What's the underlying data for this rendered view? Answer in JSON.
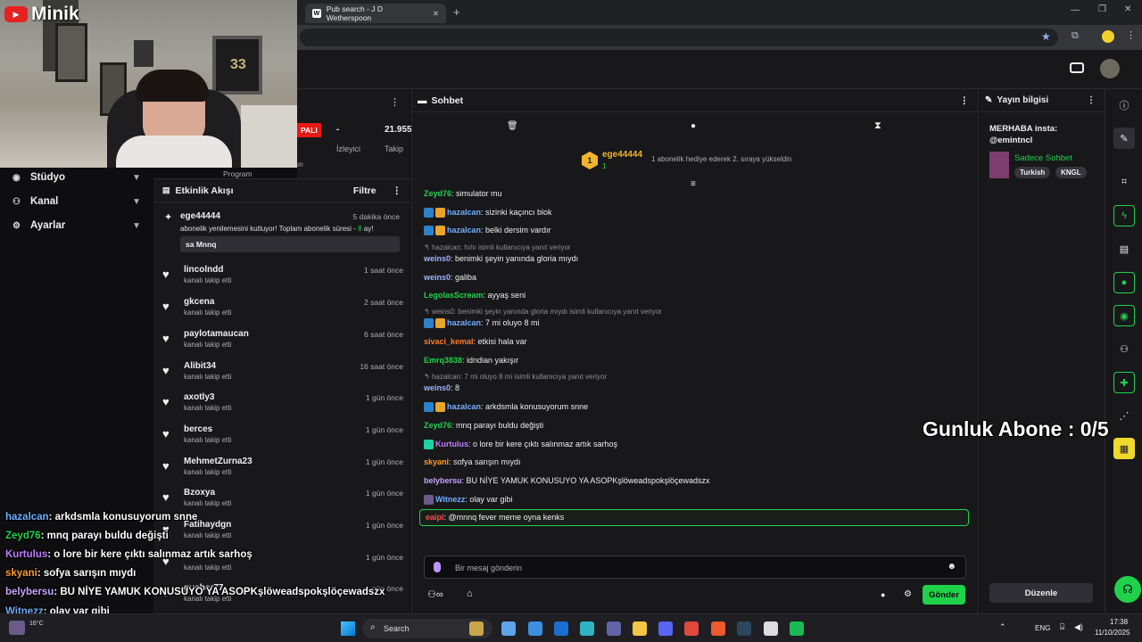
{
  "browser": {
    "tab_title": "Pub search - J D Wetherspoon",
    "tab_favicon": "W"
  },
  "webcam": {
    "logo_text": "Minik",
    "frame_text": "33"
  },
  "left_nav": {
    "items": [
      {
        "label": "Stüdyo",
        "icon": "video-icon"
      },
      {
        "label": "Kanal",
        "icon": "people-icon"
      },
      {
        "label": "Ayarlar",
        "icon": "gear-icon"
      }
    ]
  },
  "stats": {
    "live_badge": "PALI",
    "col1_value": "-",
    "col1_label": "İzleyici",
    "col2_value": "21.955",
    "col2_label": "Takip",
    "program_label": "Program",
    "partial_label": "ın"
  },
  "activity": {
    "title": "Etkinlik Akışı",
    "filter_label": "Filtre",
    "featured": {
      "user": "ege44444",
      "time": "5 dakika önce",
      "text_pre": "abonelik yenilemesini kutluyor! Toplam abonelik süresi - ",
      "months": "8",
      "text_post": " ay!",
      "message": "sa Mnnq"
    },
    "items": [
      {
        "user": "lincolndd",
        "sub": "kanalı takip etti",
        "time": "1 saat önce"
      },
      {
        "user": "gkcena",
        "sub": "kanalı takip etti",
        "time": "2 saat önce"
      },
      {
        "user": "paylotamaucan",
        "sub": "kanalı takip etti",
        "time": "6 saat önce"
      },
      {
        "user": "Alibit34",
        "sub": "kanalı takip etti",
        "time": "16 saat önce"
      },
      {
        "user": "axotly3",
        "sub": "kanalı takip etti",
        "time": "1 gün önce"
      },
      {
        "user": "berces",
        "sub": "kanalı takip etti",
        "time": "1 gün önce"
      },
      {
        "user": "MehmetZurna23",
        "sub": "kanalı takip etti",
        "time": "1 gün önce"
      },
      {
        "user": "Bzoxya",
        "sub": "kanalı takip etti",
        "time": "1 gün önce"
      },
      {
        "user": "Fatihaydgn",
        "sub": "kanalı takip etti",
        "time": "1 gün önce"
      },
      {
        "user": "",
        "sub": "kanalı takip etti",
        "time": "1 gün önce"
      },
      {
        "user": "gusher77",
        "sub": "kanalı takip etti",
        "time": "1 gün önce"
      }
    ]
  },
  "chat": {
    "title": "Sohbet",
    "pinned": {
      "level": "1",
      "user": "ege44444",
      "count": "1",
      "text": "1 abonelik hediye ederek 2. sıraya yükseldin"
    },
    "messages": [
      {
        "user": "Zeyd76",
        "color": "#1fd24a",
        "badges": [],
        "text": ": simulator mu"
      },
      {
        "user": "hazalcan",
        "color": "#6fb0ff",
        "badges": [
          "#2c83c9",
          "#e8a52b"
        ],
        "text": ": sizinki kaçıncı blok"
      },
      {
        "user": "hazalcan",
        "color": "#6fb0ff",
        "badges": [
          "#2c83c9",
          "#e8a52b"
        ],
        "text": ": belki dersim vardır"
      },
      {
        "reply": "hazalcan: hıhı isimli kullanıcıya yanıt veriyor"
      },
      {
        "user": "weins0",
        "color": "#9eb4ff",
        "badges": [],
        "text": ": benimki şeyin yanında gloria mıydı"
      },
      {
        "user": "weins0",
        "color": "#9eb4ff",
        "badges": [],
        "text": ": galiba"
      },
      {
        "user": "LegolasScream",
        "color": "#1fd24a",
        "badges": [],
        "text": ": ayyaş seni"
      },
      {
        "reply": "weins0: benimki şeyin yanında gloria mıydı isimli kullanıcıya yanıt veriyor"
      },
      {
        "user": "hazalcan",
        "color": "#6fb0ff",
        "badges": [
          "#2c83c9",
          "#e8a52b"
        ],
        "text": ": 7 mi oluyo 8 mi"
      },
      {
        "user": "sivaci_kemal",
        "color": "#ff7b2c",
        "badges": [],
        "text": ": etkisi hala var"
      },
      {
        "user": "Emrq3838",
        "color": "#1fd24a",
        "badges": [],
        "text": ": idndian yakışır"
      },
      {
        "reply": "hazalcan: 7 mi oluyo 8 mi isimli kullanıcıya yanıt veriyor"
      },
      {
        "user": "weins0",
        "color": "#9eb4ff",
        "badges": [],
        "text": ": 8"
      },
      {
        "user": "hazalcan",
        "color": "#6fb0ff",
        "badges": [
          "#2c83c9",
          "#e8a52b"
        ],
        "text": ": arkdsmla konusuyorum snne"
      },
      {
        "user": "Zeyd76",
        "color": "#1fd24a",
        "badges": [],
        "text": ": mnq parayı buldu değişti"
      },
      {
        "user": "Kurtulus",
        "color": "#c27cff",
        "badges": [
          "#1fd2a3"
        ],
        "text": ": o lore bir kere çıktı salınmaz artık sarhoş"
      },
      {
        "user": "skyani",
        "color": "#ff9a2c",
        "badges": [],
        "text": ": sofya sarışın mıydı"
      },
      {
        "user": "belybersu",
        "color": "#c9a3ff",
        "badges": [],
        "text": ": BU NİYE YAMUK KONUSUYO YA ASOPKşlöweadspokşlöçewadszx"
      },
      {
        "user": "Witnezz",
        "color": "#6fb0ff",
        "badges": [
          "#6b5a8a"
        ],
        "text": ": olay var gibi"
      }
    ],
    "highlight": {
      "user": "eaipi",
      "text": ": @mnnq fever meme oyna kenks"
    },
    "input_placeholder": "Bir mesaj gönderin",
    "send_label": "Gönder"
  },
  "stream_info": {
    "title": "Yayın bilgisi",
    "stream_title": "MERHABA insta: @emintncl",
    "category": "Sadece Sohbet",
    "tags": [
      "Turkish",
      "KNGL"
    ],
    "edit_label": "Düzenle"
  },
  "overlay": {
    "sub_goal": "Gunluk Abone : 0/5",
    "chat": [
      {
        "user": "hazalcan",
        "color": "#6fb0ff",
        "text": ": arkdsmla konusuyorum snne"
      },
      {
        "user": "Zeyd76",
        "color": "#1fd24a",
        "text": ": mnq parayı buldu değişti"
      },
      {
        "user": "Kurtulus",
        "color": "#c27cff",
        "text": ": o lore bir kere çıktı salınmaz artık sarhoş"
      },
      {
        "user": "skyani",
        "color": "#ff9a2c",
        "text": ": sofya sarışın mıydı"
      },
      {
        "user": "belybersu",
        "color": "#c9a3ff",
        "text": ": BU NİYE YAMUK KONUSUYO YA ASOPKşlöweadspokşlöçewadszx"
      },
      {
        "user": "Witnezz",
        "color": "#6fb0ff",
        "text": ": olay var gibi"
      },
      {
        "user": "eaipi",
        "color": "#ff4b4b",
        "text": ": @mnnq fever meme oyna kenks"
      }
    ]
  },
  "taskbar": {
    "search_label": "Search",
    "weather": "16°C",
    "lang": "ENG",
    "time": "17:38",
    "date": "11/10/2025"
  }
}
